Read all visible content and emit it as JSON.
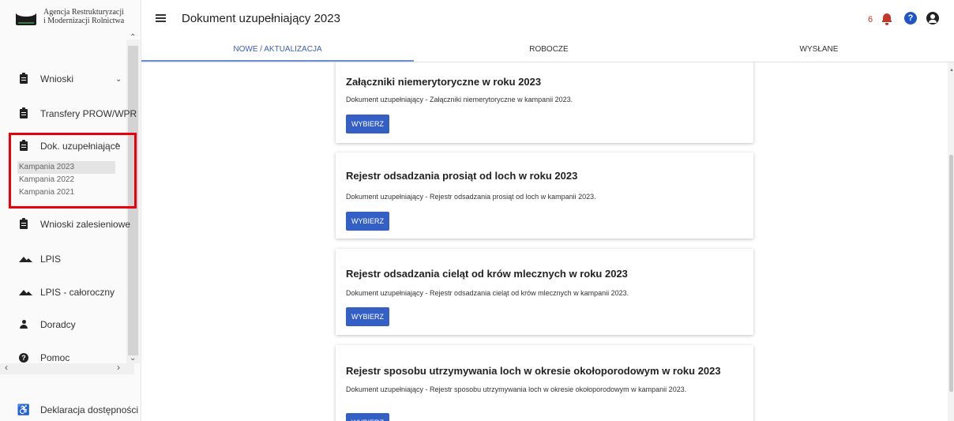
{
  "brand": {
    "line1": "Agencja Restrukturyzacji",
    "line2": "i Modernizacji Rolnictwa"
  },
  "header": {
    "title": "Dokument uzupełniający 2023",
    "notification_count": "6",
    "icons": [
      "menu-icon",
      "bell-icon",
      "help-icon",
      "user-icon"
    ],
    "accent_color": "#3460c6",
    "notification_color": "#c0392b"
  },
  "tabs": [
    {
      "label": "NOWE / AKTUALIZACJA",
      "active": true
    },
    {
      "label": "ROBOCZE",
      "active": false
    },
    {
      "label": "WYSŁANE",
      "active": false
    }
  ],
  "sidebar": {
    "items": [
      {
        "label": "Wnioski",
        "icon": "clipboard-icon",
        "chevron": "⌄"
      },
      {
        "label": "Transfery PROW/WPR",
        "icon": "clipboard-icon"
      },
      {
        "label": "Dok. uzupełniające",
        "icon": "clipboard-icon",
        "chevron": "^"
      },
      {
        "label": "Wnioski zalesieniowe",
        "icon": "clipboard-icon"
      },
      {
        "label": "LPIS",
        "icon": "mountain-icon"
      },
      {
        "label": "LPIS - całoroczny",
        "icon": "mountain-icon"
      },
      {
        "label": "Doradcy",
        "icon": "person-icon"
      },
      {
        "label": "Pomoc",
        "icon": "help-icon"
      },
      {
        "label": "Deklaracja dostępności",
        "icon": "accessibility-icon"
      }
    ],
    "submenu": [
      {
        "label": "Kampania 2023",
        "active": true
      },
      {
        "label": "Kampania 2022",
        "active": false
      },
      {
        "label": "Kampania 2021",
        "active": false
      }
    ]
  },
  "cards": [
    {
      "title": "Załączniki niemerytoryczne w roku 2023",
      "description": "Dokument uzupełniający - Załączniki niemerytoryczne w kampanii 2023.",
      "button": "WYBIERZ"
    },
    {
      "title": "Rejestr odsadzania prosiąt od loch w roku 2023",
      "description": "Dokument uzupełniający - Rejestr odsadzania prosiąt od loch w kampanii 2023.",
      "button": "WYBIERZ"
    },
    {
      "title": "Rejestr odsadzania cieląt od krów mlecznych w roku 2023",
      "description": "Dokument uzupełniający - Rejestr odsadzania cieląt od krów mlecznych w kampanii 2023.",
      "button": "WYBIERZ"
    },
    {
      "title": "Rejestr sposobu utrzymywania loch w okresie okołoporodowym w roku 2023",
      "description": "Dokument uzupełniający - Rejestr sposobu utrzymywania loch w okresie okołoporodowym w kampanii 2023.",
      "button": "WYBIERZ"
    }
  ]
}
